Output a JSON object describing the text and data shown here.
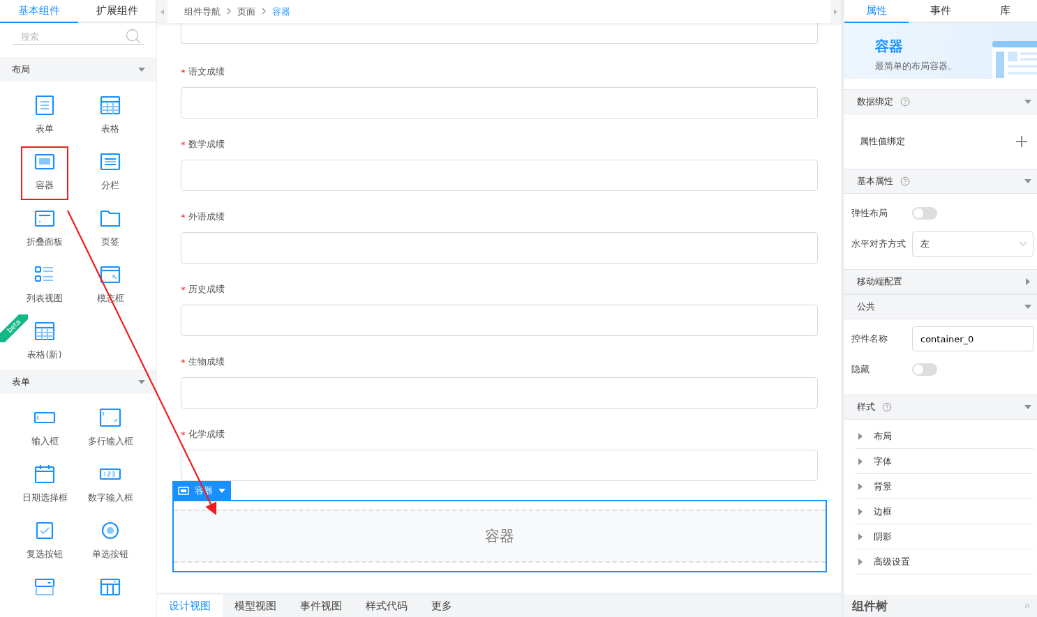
{
  "left_panel": {
    "tabs": [
      {
        "label": "基本组件",
        "selected": true
      },
      {
        "label": "扩展组件",
        "selected": false
      }
    ],
    "search": {
      "placeholder": "搜索"
    },
    "groups": [
      {
        "title": "布局",
        "expanded": true,
        "items": [
          {
            "label": "表单",
            "highlighted": false
          },
          {
            "label": "表格",
            "highlighted": false
          },
          {
            "label": "容器",
            "highlighted": true
          },
          {
            "label": "分栏",
            "highlighted": false
          },
          {
            "label": "折叠面板",
            "highlighted": false
          },
          {
            "label": "页签",
            "highlighted": false
          },
          {
            "label": "列表视图",
            "highlighted": false
          },
          {
            "label": "模态框",
            "highlighted": false
          },
          {
            "label": "表格(新)",
            "badge": "beta",
            "highlighted": false
          }
        ]
      },
      {
        "title": "表单",
        "expanded": true,
        "items": [
          {
            "label": "输入框",
            "highlighted": false
          },
          {
            "label": "多行输入框",
            "highlighted": false
          },
          {
            "label": "日期选择框",
            "highlighted": false
          },
          {
            "label": "数字输入框",
            "highlighted": false
          },
          {
            "label": "复选按钮",
            "highlighted": false
          },
          {
            "label": "单选按钮",
            "highlighted": false
          },
          {
            "highlighted": false
          },
          {
            "highlighted": false
          }
        ]
      }
    ]
  },
  "breadcrumb": [
    {
      "label": "组件导航",
      "current": false
    },
    {
      "label": "页面",
      "current": false
    },
    {
      "label": "容器",
      "current": true
    }
  ],
  "form_fields": [
    {
      "label": "语文成绩",
      "mark": "*"
    },
    {
      "label": "数学成绩",
      "mark": "*"
    },
    {
      "label": "外语成绩",
      "mark": "*"
    },
    {
      "label": "历史成绩",
      "mark": "*"
    },
    {
      "label": "生物成绩",
      "mark": "*"
    },
    {
      "label": "化学成绩",
      "mark": "*"
    }
  ],
  "selected_component": {
    "tag": "容器",
    "content": "容器"
  },
  "bottom_tabs": [
    {
      "label": "设计视图",
      "selected": true
    },
    {
      "label": "模型视图",
      "selected": false
    },
    {
      "label": "事件视图",
      "selected": false
    },
    {
      "label": "样式代码",
      "selected": false
    },
    {
      "label": "更多",
      "selected": false
    }
  ],
  "right_panel": {
    "tabs": [
      {
        "label": "属性",
        "selected": true
      },
      {
        "label": "事件",
        "selected": false
      },
      {
        "label": "库",
        "selected": false
      }
    ],
    "banner": {
      "title": "容器",
      "description": "最简单的布局容器。"
    },
    "sections": [
      {
        "kind": "binding",
        "title": "数据绑定",
        "help": true,
        "expanded": true,
        "rows": [
          {
            "label": "属性值绑定"
          }
        ]
      },
      {
        "kind": "fields",
        "title": "基本属性",
        "help": true,
        "expanded": true,
        "fields": [
          {
            "kind": "switch",
            "label": "弹性布局",
            "on": false
          },
          {
            "kind": "select",
            "label": "水平对齐方式",
            "value": "左"
          }
        ]
      },
      {
        "title": "移动端配置",
        "help": false,
        "expanded": false
      },
      {
        "kind": "fields",
        "title": "公共",
        "help": false,
        "expanded": true,
        "fields": [
          {
            "kind": "input",
            "label": "控件名称",
            "value": "container_0"
          },
          {
            "kind": "switch",
            "label": "隐藏",
            "on": false
          }
        ]
      },
      {
        "kind": "list",
        "title": "样式",
        "help": true,
        "expanded": true,
        "items": [
          "布局",
          "字体",
          "背景",
          "边框",
          "阴影",
          "高级设置"
        ]
      }
    ],
    "footer": {
      "title": "组件树"
    }
  }
}
